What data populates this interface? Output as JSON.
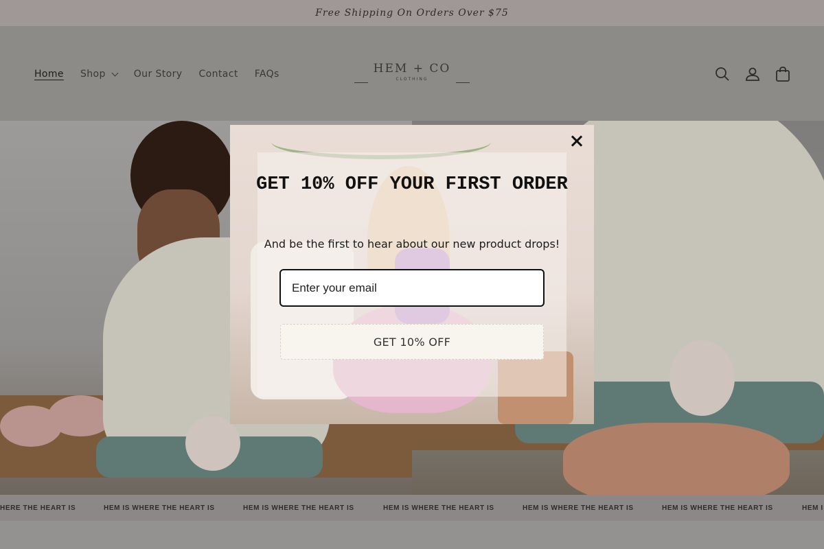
{
  "announcement": {
    "text": "Free Shipping On Orders Over $75"
  },
  "nav": {
    "items": [
      {
        "label": "Home",
        "active": true
      },
      {
        "label": "Shop",
        "has_dropdown": true
      },
      {
        "label": "Our Story"
      },
      {
        "label": "Contact"
      },
      {
        "label": "FAQs"
      }
    ]
  },
  "logo": {
    "main": "HEM + CO",
    "sub": "CLOTHING"
  },
  "header_icons": [
    "search-icon",
    "account-icon",
    "cart-icon"
  ],
  "marquee": {
    "text": "HEM IS WHERE THE HEART IS",
    "first_partial": "HERE THE HEART IS",
    "last_partial": "HEM I"
  },
  "popup": {
    "title": "GET 10% OFF YOUR FIRST ORDER",
    "subtitle": "And be the first to hear about our new product drops!",
    "email_placeholder": "Enter your email",
    "button_label": "GET 10% OFF"
  },
  "colors": {
    "overlay_bg": "#8d8b88",
    "announcement_bg": "#a09896",
    "button_bg": "#f8f5ef"
  }
}
